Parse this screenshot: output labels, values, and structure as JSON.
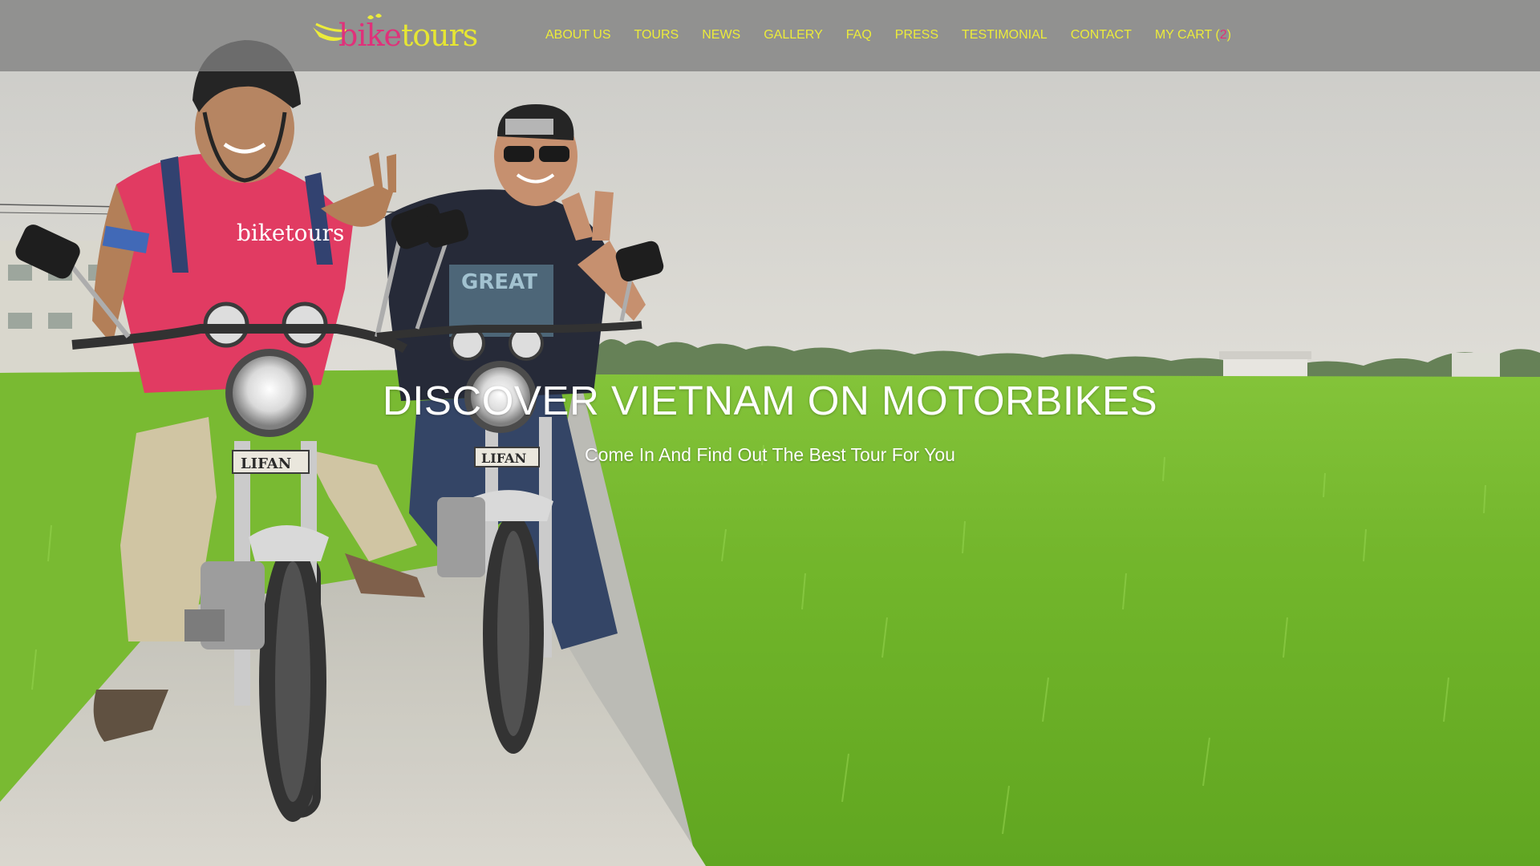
{
  "brand": {
    "logo_prefix": "bike",
    "logo_suffix": "tours",
    "logo_dots": "\"",
    "primary_color": "#ecec3a",
    "accent_color": "#e0317a"
  },
  "nav": {
    "items": [
      {
        "label": "ABOUT US"
      },
      {
        "label": "TOURS"
      },
      {
        "label": "NEWS"
      },
      {
        "label": "GALLERY"
      },
      {
        "label": "FAQ"
      },
      {
        "label": "PRESS"
      },
      {
        "label": "TESTIMONIAL"
      },
      {
        "label": "CONTACT"
      }
    ],
    "cart": {
      "label": "MY CART (",
      "count": "2",
      "close": ")"
    }
  },
  "hero": {
    "title": "DISCOVER VIETNAM ON MOTORBIKES",
    "subtitle": "Come In And Find Out The Best Tour For You",
    "shirt_logo": "biketours",
    "plate_left": "LIFAN",
    "plate_right": "LIFAN",
    "shirt_graphic": "GREAT"
  }
}
